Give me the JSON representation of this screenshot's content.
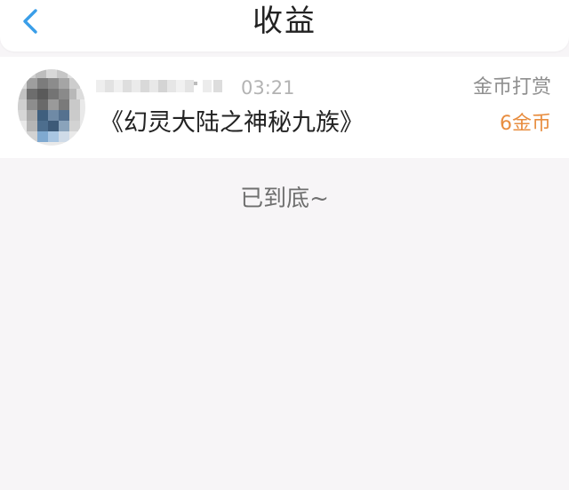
{
  "header": {
    "title": "收益",
    "back_icon": "chevron-left-icon",
    "accent_color": "#3a9ee8"
  },
  "earnings": [
    {
      "time": "03:21",
      "book_title": "《幻灵大陆之神秘九族》",
      "reward_type": "金币打赏",
      "reward_amount": "6金币",
      "amount_color": "#e88d3f"
    }
  ],
  "footer": {
    "end_text": "已到底~"
  }
}
